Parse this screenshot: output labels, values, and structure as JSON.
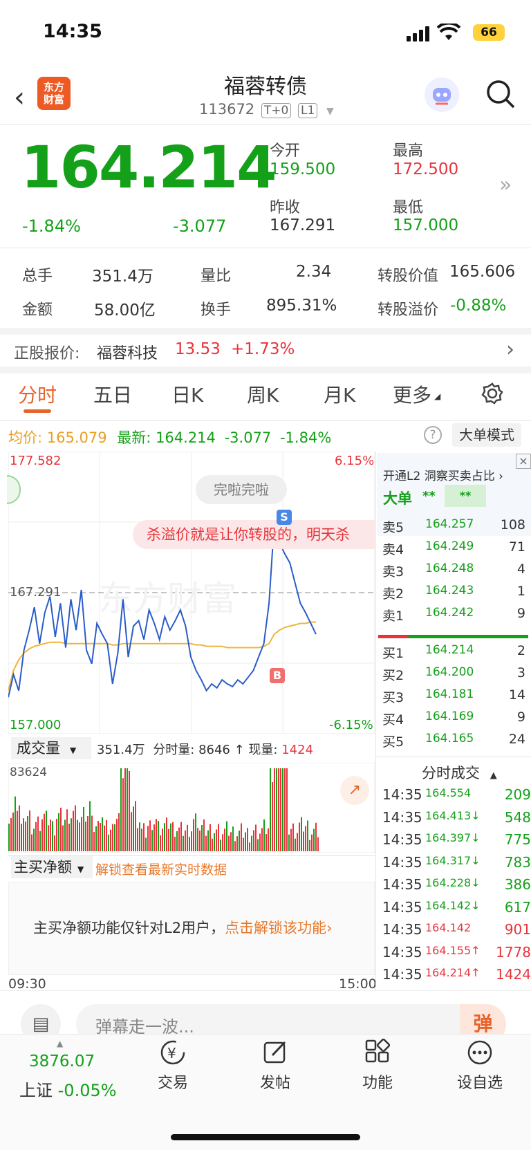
{
  "status": {
    "time": "14:35",
    "battery": "66"
  },
  "header": {
    "logo_line1": "东方",
    "logo_line2": "财富",
    "title": "福蓉转债",
    "code": "113672",
    "tag1": "T+0",
    "tag2": "L1"
  },
  "quote": {
    "price": "164.214",
    "change_pct": "-1.84%",
    "change": "-3.077",
    "open_label": "今开",
    "open": "159.500",
    "high_label": "最高",
    "high": "172.500",
    "prev_label": "昨收",
    "prev": "167.291",
    "low_label": "最低",
    "low": "157.000"
  },
  "stats": {
    "vol_label": "总手",
    "vol": "351.4万",
    "ratio_label": "量比",
    "ratio": "2.34",
    "conv_value_label": "转股价值",
    "conv_value": "165.606",
    "amount_label": "金额",
    "amount": "58.00亿",
    "turnover_label": "换手",
    "turnover": "895.31%",
    "premium_label": "转股溢价",
    "premium": "-0.88%"
  },
  "stock": {
    "label": "正股报价:",
    "name": "福蓉科技",
    "price": "13.53",
    "pct": "+1.73%"
  },
  "tabs": [
    "分时",
    "五日",
    "日K",
    "周K",
    "月K",
    "更多"
  ],
  "infobar": {
    "avg_label": "均价:",
    "avg": "165.079",
    "last_label": "最新:",
    "last": "164.214",
    "chg": "-3.077",
    "pct": "-1.84%",
    "mode_button": "大单模式"
  },
  "chart_labels": {
    "top_price": "177.582",
    "top_pct": "6.15%",
    "prev_close": "167.291",
    "bottom_price": "157.000",
    "bottom_pct": "-6.15%",
    "comment1": "完啦完啦",
    "comment2": "杀溢价就是让你转股的，明天杀",
    "watermark": "东方财富",
    "marker_s": "S",
    "marker_b": "B"
  },
  "volume_bar": {
    "selector": "成交量",
    "total": "351.4万",
    "minute_label": "分时量:",
    "minute": "8646",
    "now_label": "现量:",
    "now": "1424",
    "max": "83624"
  },
  "netbuy": {
    "selector": "主买净额",
    "unlock": "解锁查看最新实时数据",
    "notice": "主买净额功能仅针对L2用户，",
    "notice_link": "点击解锁该功能",
    "time_start": "09:30",
    "time_end": "15:00"
  },
  "orderbook": {
    "banner": "开通L2 洞察买卖占比",
    "bigorder": "大单",
    "stars1": "**",
    "stars2": "**",
    "asks": [
      {
        "label": "卖5",
        "price": "164.257",
        "qty": "108"
      },
      {
        "label": "卖4",
        "price": "164.249",
        "qty": "71"
      },
      {
        "label": "卖3",
        "price": "164.248",
        "qty": "4"
      },
      {
        "label": "卖2",
        "price": "164.243",
        "qty": "1"
      },
      {
        "label": "卖1",
        "price": "164.242",
        "qty": "9"
      }
    ],
    "bids": [
      {
        "label": "买1",
        "price": "164.214",
        "qty": "2"
      },
      {
        "label": "买2",
        "price": "164.200",
        "qty": "3"
      },
      {
        "label": "买3",
        "price": "164.181",
        "qty": "14"
      },
      {
        "label": "买4",
        "price": "164.169",
        "qty": "9"
      },
      {
        "label": "买5",
        "price": "164.165",
        "qty": "24"
      }
    ]
  },
  "trades": {
    "title": "分时成交",
    "rows": [
      {
        "time": "14:35",
        "price": "164.554",
        "dir": "",
        "qty": "209",
        "color": "green"
      },
      {
        "time": "14:35",
        "price": "164.413",
        "dir": "↓",
        "qty": "548",
        "color": "green"
      },
      {
        "time": "14:35",
        "price": "164.397",
        "dir": "↓",
        "qty": "775",
        "color": "green"
      },
      {
        "time": "14:35",
        "price": "164.317",
        "dir": "↓",
        "qty": "783",
        "color": "green"
      },
      {
        "time": "14:35",
        "price": "164.228",
        "dir": "↓",
        "qty": "386",
        "color": "green"
      },
      {
        "time": "14:35",
        "price": "164.142",
        "dir": "↓",
        "qty": "617",
        "color": "green"
      },
      {
        "time": "14:35",
        "price": "164.142",
        "dir": "",
        "qty": "901",
        "color": "red"
      },
      {
        "time": "14:35",
        "price": "164.155",
        "dir": "↑",
        "qty": "1778",
        "color": "red"
      },
      {
        "time": "14:35",
        "price": "164.214",
        "dir": "↑",
        "qty": "1424",
        "color": "red"
      }
    ]
  },
  "danmu": {
    "placeholder": "弹幕走一波...",
    "button": "弹"
  },
  "bottom": {
    "index_value": "3876.07",
    "index_name": "上证",
    "index_pct": "-0.05%",
    "nav": [
      "交易",
      "发帖",
      "功能",
      "设自选"
    ]
  },
  "chart_data": {
    "type": "line",
    "title": "",
    "y_range": [
      157.0,
      177.582
    ],
    "prev_close": 167.291,
    "x_range": [
      "09:30",
      "15:00"
    ],
    "series": [
      {
        "values": [
          159.5,
          161.2,
          160.0,
          163.0,
          164.5,
          166.2,
          163.5,
          165.8,
          167.0,
          164.0,
          166.5,
          163.2,
          166.8,
          164.5,
          167.5,
          163.0,
          162.0,
          165.0,
          164.2,
          163.5,
          160.5,
          162.8,
          166.8,
          162.5,
          164.8,
          165.2,
          163.8,
          166.0,
          165.0,
          163.8,
          165.5,
          164.5,
          165.2,
          166.0,
          164.8,
          162.5,
          161.5,
          160.8,
          160.0,
          160.5,
          160.2,
          160.8,
          160.5,
          160.3,
          160.8,
          160.5,
          161.0,
          161.5,
          162.5,
          163.5,
          166.5,
          172.5,
          171.0,
          170.2,
          169.5,
          168.0,
          166.5,
          165.8,
          165.0,
          164.2
        ]
      },
      {
        "values": [
          160.0,
          161.5,
          162.3,
          162.8,
          163.1,
          163.3,
          163.4,
          163.5,
          163.6,
          163.6,
          163.6,
          163.5,
          163.5,
          163.5,
          163.5,
          163.5,
          163.5,
          163.5,
          163.5,
          163.5,
          163.4,
          163.4,
          163.5,
          163.5,
          163.5,
          163.5,
          163.5,
          163.5,
          163.5,
          163.5,
          163.5,
          163.5,
          163.5,
          163.5,
          163.5,
          163.5,
          163.4,
          163.4,
          163.3,
          163.3,
          163.3,
          163.3,
          163.2,
          163.2,
          163.2,
          163.2,
          163.2,
          163.2,
          163.2,
          163.3,
          163.5,
          164.2,
          164.5,
          164.7,
          164.8,
          164.9,
          165.0,
          165.0,
          165.1,
          165.1
        ]
      }
    ]
  }
}
